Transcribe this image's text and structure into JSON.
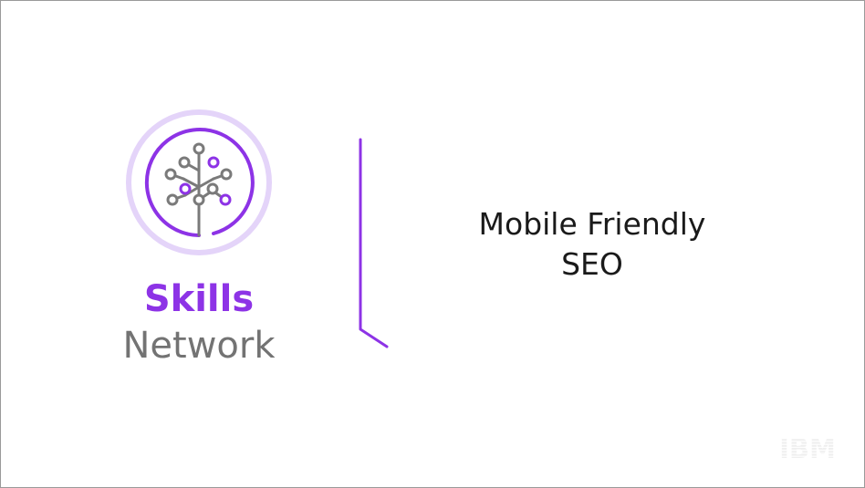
{
  "brand": {
    "line1": "Skills",
    "line2": "Network",
    "logo_icon": "skills-network-tree-icon"
  },
  "title": {
    "line1": "Mobile Friendly",
    "line2": "SEO"
  },
  "footer": {
    "logo_text": "IBM"
  },
  "colors": {
    "accent": "#8d33e6",
    "accent_light": "#e2d0f8",
    "gray": "#737373",
    "text": "#1a1a1a"
  }
}
